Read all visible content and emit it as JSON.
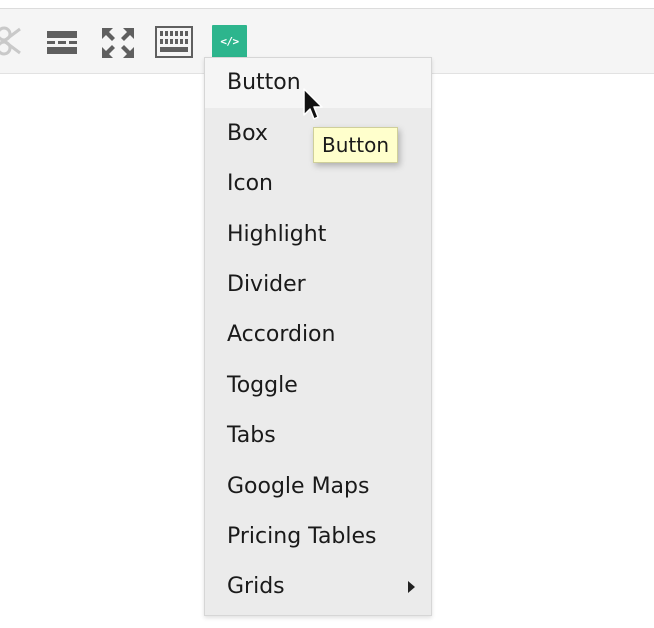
{
  "toolbar": {
    "icons": [
      {
        "name": "special-character-icon"
      },
      {
        "name": "horizontal-rule-icon"
      },
      {
        "name": "fullscreen-icon"
      },
      {
        "name": "keyboard-shortcuts-icon"
      },
      {
        "name": "shortcodes-icon",
        "label": "</>",
        "active": true
      }
    ],
    "accent_color": "#2db58d"
  },
  "menu": {
    "items": [
      {
        "label": "Button",
        "hovered": true
      },
      {
        "label": "Box"
      },
      {
        "label": "Icon"
      },
      {
        "label": "Highlight"
      },
      {
        "label": "Divider"
      },
      {
        "label": "Accordion"
      },
      {
        "label": "Toggle"
      },
      {
        "label": "Tabs"
      },
      {
        "label": "Google Maps"
      },
      {
        "label": "Pricing Tables"
      },
      {
        "label": "Grids",
        "has_submenu": true
      }
    ]
  },
  "tooltip": {
    "text": "Button"
  }
}
